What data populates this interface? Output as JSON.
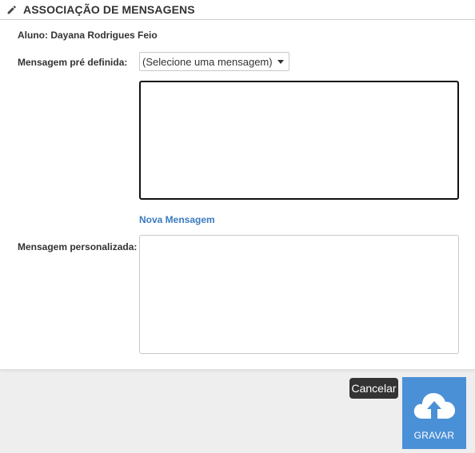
{
  "header": {
    "title": "ASSOCIAÇÃO DE MENSAGENS",
    "icon": "pencil-icon"
  },
  "student": {
    "text": "Aluno: Dayana Rodrigues Feio"
  },
  "predefined": {
    "label": "Mensagem pré definida:",
    "selected": "(Selecione uma mensagem)",
    "message_text": ""
  },
  "new_message_link": "Nova Mensagem",
  "custom": {
    "label": "Mensagem personalizada:",
    "value": ""
  },
  "actions": {
    "cancel_label": "Cancelar",
    "save_label": "GRAVAR",
    "save_icon": "cloud-upload-icon"
  },
  "colors": {
    "accent": "#4a90d6",
    "link": "#3a7bbf",
    "cancel_bg": "#333333"
  }
}
